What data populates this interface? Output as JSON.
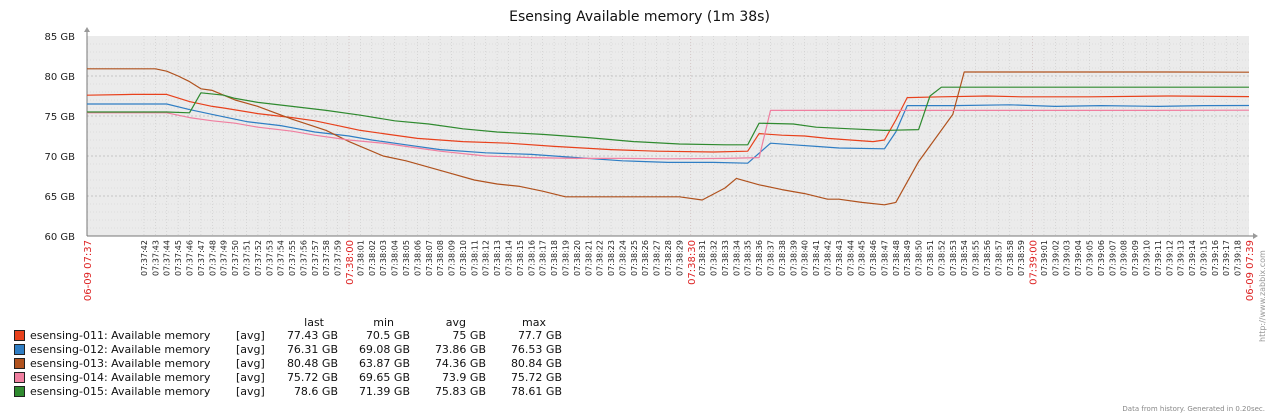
{
  "chart_data": {
    "type": "line",
    "title": "Esensing Available memory (1m 38s)",
    "y_unit": "GB",
    "ylim": [
      60,
      85
    ],
    "y_ticks": [
      "60 GB",
      "65 GB",
      "70 GB",
      "75 GB",
      "80 GB",
      "85 GB"
    ],
    "grid": true,
    "x_start_label": "06-09 07:37",
    "x_end_label": "06-09 07:39",
    "x_tick_labels": [
      "07:37:42",
      "07:37:43",
      "07:37:44",
      "07:37:45",
      "07:37:46",
      "07:37:47",
      "07:37:48",
      "07:37:49",
      "07:37:50",
      "07:37:51",
      "07:37:52",
      "07:37:53",
      "07:37:54",
      "07:37:55",
      "07:37:56",
      "07:37:57",
      "07:37:58",
      "07:37:59",
      "07:38:00",
      "07:38:01",
      "07:38:02",
      "07:38:03",
      "07:38:04",
      "07:38:05",
      "07:38:06",
      "07:38:07",
      "07:38:08",
      "07:38:09",
      "07:38:10",
      "07:38:11",
      "07:38:12",
      "07:38:13",
      "07:38:14",
      "07:38:15",
      "07:38:16",
      "07:38:17",
      "07:38:18",
      "07:38:19",
      "07:38:20",
      "07:38:21",
      "07:38:22",
      "07:38:23",
      "07:38:24",
      "07:38:25",
      "07:38:26",
      "07:38:27",
      "07:38:28",
      "07:38:29",
      "07:38:30",
      "07:38:31",
      "07:38:32",
      "07:38:33",
      "07:38:34",
      "07:38:35",
      "07:38:36",
      "07:38:37",
      "07:38:38",
      "07:38:39",
      "07:38:40",
      "07:38:41",
      "07:38:42",
      "07:38:43",
      "07:38:44",
      "07:38:45",
      "07:38:46",
      "07:38:47",
      "07:38:48",
      "07:38:49",
      "07:38:50",
      "07:38:51",
      "07:38:52",
      "07:38:53",
      "07:38:54",
      "07:38:55",
      "07:38:56",
      "07:38:57",
      "07:38:58",
      "07:38:59",
      "07:39:00",
      "07:39:01",
      "07:39:02",
      "07:39:03",
      "07:39:04",
      "07:39:05",
      "07:39:06",
      "07:39:07",
      "07:39:08",
      "07:39:09",
      "07:39:10",
      "07:39:11",
      "07:39:12",
      "07:39:13",
      "07:39:14",
      "07:39:15",
      "07:39:16",
      "07:39:17",
      "07:39:18"
    ],
    "x_highlight_labels": [
      "07:38:00",
      "07:38:30",
      "07:39:00"
    ],
    "x_range_seconds": [
      37,
      139
    ],
    "series": [
      {
        "name": "esensing-011: Available memory",
        "func": "[avg]",
        "color": "#e8411c",
        "last": "77.43 GB",
        "min": "70.5 GB",
        "avg": "75 GB",
        "max": "77.7 GB",
        "points": [
          [
            37,
            77.6
          ],
          [
            41,
            77.7
          ],
          [
            44,
            77.7
          ],
          [
            46,
            76.8
          ],
          [
            48,
            76.2
          ],
          [
            49,
            76.0
          ],
          [
            52,
            75.3
          ],
          [
            55,
            74.8
          ],
          [
            57,
            74.4
          ],
          [
            59,
            73.8
          ],
          [
            61,
            73.2
          ],
          [
            63,
            72.8
          ],
          [
            66,
            72.2
          ],
          [
            70,
            71.8
          ],
          [
            74,
            71.6
          ],
          [
            78,
            71.2
          ],
          [
            83,
            70.8
          ],
          [
            87,
            70.6
          ],
          [
            92,
            70.5
          ],
          [
            95,
            70.6
          ],
          [
            96,
            72.8
          ],
          [
            98,
            72.6
          ],
          [
            100,
            72.5
          ],
          [
            102,
            72.2
          ],
          [
            104,
            72.0
          ],
          [
            106,
            71.8
          ],
          [
            107,
            72.0
          ],
          [
            108,
            74.5
          ],
          [
            109,
            77.3
          ],
          [
            112,
            77.4
          ],
          [
            116,
            77.5
          ],
          [
            119,
            77.4
          ],
          [
            121,
            77.4
          ],
          [
            125,
            77.4
          ],
          [
            132,
            77.5
          ],
          [
            139,
            77.43
          ]
        ]
      },
      {
        "name": "esensing-012: Available memory",
        "func": "[avg]",
        "color": "#2f7ec4",
        "last": "76.31 GB",
        "min": "69.08 GB",
        "avg": "73.86 GB",
        "max": "76.53 GB",
        "points": [
          [
            37,
            76.5
          ],
          [
            41,
            76.5
          ],
          [
            44,
            76.5
          ],
          [
            46,
            75.8
          ],
          [
            48,
            75.2
          ],
          [
            51,
            74.3
          ],
          [
            54,
            73.8
          ],
          [
            57,
            73.0
          ],
          [
            60,
            72.5
          ],
          [
            62,
            72.0
          ],
          [
            65,
            71.4
          ],
          [
            68,
            70.8
          ],
          [
            72,
            70.4
          ],
          [
            76,
            70.2
          ],
          [
            80,
            69.8
          ],
          [
            84,
            69.4
          ],
          [
            88,
            69.2
          ],
          [
            92,
            69.2
          ],
          [
            95,
            69.1
          ],
          [
            97,
            71.6
          ],
          [
            99,
            71.4
          ],
          [
            101,
            71.2
          ],
          [
            103,
            71.0
          ],
          [
            107,
            70.9
          ],
          [
            108,
            73.0
          ],
          [
            109,
            76.3
          ],
          [
            113,
            76.3
          ],
          [
            118,
            76.4
          ],
          [
            122,
            76.2
          ],
          [
            126,
            76.3
          ],
          [
            131,
            76.2
          ],
          [
            135,
            76.3
          ],
          [
            139,
            76.31
          ]
        ]
      },
      {
        "name": "esensing-013: Available memory",
        "func": "[avg]",
        "color": "#b0521e",
        "last": "80.48 GB",
        "min": "63.87 GB",
        "avg": "74.36 GB",
        "max": "80.84 GB",
        "points": [
          [
            37,
            80.9
          ],
          [
            41,
            80.9
          ],
          [
            43,
            80.9
          ],
          [
            44,
            80.6
          ],
          [
            45,
            80.0
          ],
          [
            46,
            79.3
          ],
          [
            47,
            78.4
          ],
          [
            48,
            78.2
          ],
          [
            49,
            77.6
          ],
          [
            50,
            77.0
          ],
          [
            51,
            76.6
          ],
          [
            52,
            76.2
          ],
          [
            55,
            74.6
          ],
          [
            58,
            73.2
          ],
          [
            60,
            71.8
          ],
          [
            63,
            70.0
          ],
          [
            65,
            69.4
          ],
          [
            67,
            68.6
          ],
          [
            69,
            67.8
          ],
          [
            71,
            67.0
          ],
          [
            73,
            66.5
          ],
          [
            75,
            66.2
          ],
          [
            77,
            65.6
          ],
          [
            79,
            64.9
          ],
          [
            83,
            64.9
          ],
          [
            89,
            64.9
          ],
          [
            91,
            64.5
          ],
          [
            93,
            66.0
          ],
          [
            94,
            67.2
          ],
          [
            96,
            66.4
          ],
          [
            98,
            65.8
          ],
          [
            100,
            65.3
          ],
          [
            102,
            64.6
          ],
          [
            103,
            64.6
          ],
          [
            105,
            64.2
          ],
          [
            107,
            63.9
          ],
          [
            108,
            64.2
          ],
          [
            110,
            69.3
          ],
          [
            113,
            75.2
          ],
          [
            114,
            80.5
          ],
          [
            118,
            80.5
          ],
          [
            125,
            80.5
          ],
          [
            132,
            80.5
          ],
          [
            139,
            80.48
          ]
        ]
      },
      {
        "name": "esensing-014: Available memory",
        "func": "[avg]",
        "color": "#f07fa0",
        "last": "75.72 GB",
        "min": "69.65 GB",
        "avg": "73.9 GB",
        "max": "75.72 GB",
        "points": [
          [
            37,
            75.4
          ],
          [
            41,
            75.4
          ],
          [
            44,
            75.4
          ],
          [
            46,
            74.8
          ],
          [
            48,
            74.4
          ],
          [
            50,
            74.1
          ],
          [
            52,
            73.6
          ],
          [
            55,
            73.1
          ],
          [
            57,
            72.6
          ],
          [
            60,
            72.0
          ],
          [
            63,
            71.6
          ],
          [
            66,
            71.0
          ],
          [
            68,
            70.6
          ],
          [
            72,
            70.0
          ],
          [
            76,
            69.8
          ],
          [
            80,
            69.7
          ],
          [
            84,
            69.7
          ],
          [
            88,
            69.65
          ],
          [
            93,
            69.7
          ],
          [
            96,
            69.8
          ],
          [
            97,
            75.7
          ],
          [
            105,
            75.7
          ],
          [
            112,
            75.7
          ],
          [
            120,
            75.7
          ],
          [
            130,
            75.7
          ],
          [
            139,
            75.72
          ]
        ]
      },
      {
        "name": "esensing-015: Available memory",
        "func": "[avg]",
        "color": "#2f8a2f",
        "last": "78.6 GB",
        "min": "71.39 GB",
        "avg": "75.83 GB",
        "max": "78.61 GB",
        "points": [
          [
            37,
            75.5
          ],
          [
            41,
            75.5
          ],
          [
            44,
            75.5
          ],
          [
            46,
            75.4
          ],
          [
            47,
            77.9
          ],
          [
            49,
            77.6
          ],
          [
            50,
            77.2
          ],
          [
            52,
            76.7
          ],
          [
            55,
            76.2
          ],
          [
            58,
            75.7
          ],
          [
            61,
            75.1
          ],
          [
            64,
            74.4
          ],
          [
            67,
            74.0
          ],
          [
            70,
            73.4
          ],
          [
            73,
            73.0
          ],
          [
            77,
            72.7
          ],
          [
            81,
            72.3
          ],
          [
            85,
            71.8
          ],
          [
            89,
            71.5
          ],
          [
            93,
            71.4
          ],
          [
            95,
            71.4
          ],
          [
            96,
            74.1
          ],
          [
            99,
            74.0
          ],
          [
            101,
            73.6
          ],
          [
            104,
            73.4
          ],
          [
            107,
            73.2
          ],
          [
            110,
            73.3
          ],
          [
            111,
            77.5
          ],
          [
            112,
            78.6
          ],
          [
            118,
            78.6
          ],
          [
            125,
            78.6
          ],
          [
            132,
            78.6
          ],
          [
            139,
            78.6
          ]
        ]
      }
    ]
  },
  "legend_headers": {
    "last": "last",
    "min": "min",
    "avg": "avg",
    "max": "max"
  },
  "footer": "Data from history. Generated in 0.20sec.",
  "side_text": "http://www.zabbix.com"
}
